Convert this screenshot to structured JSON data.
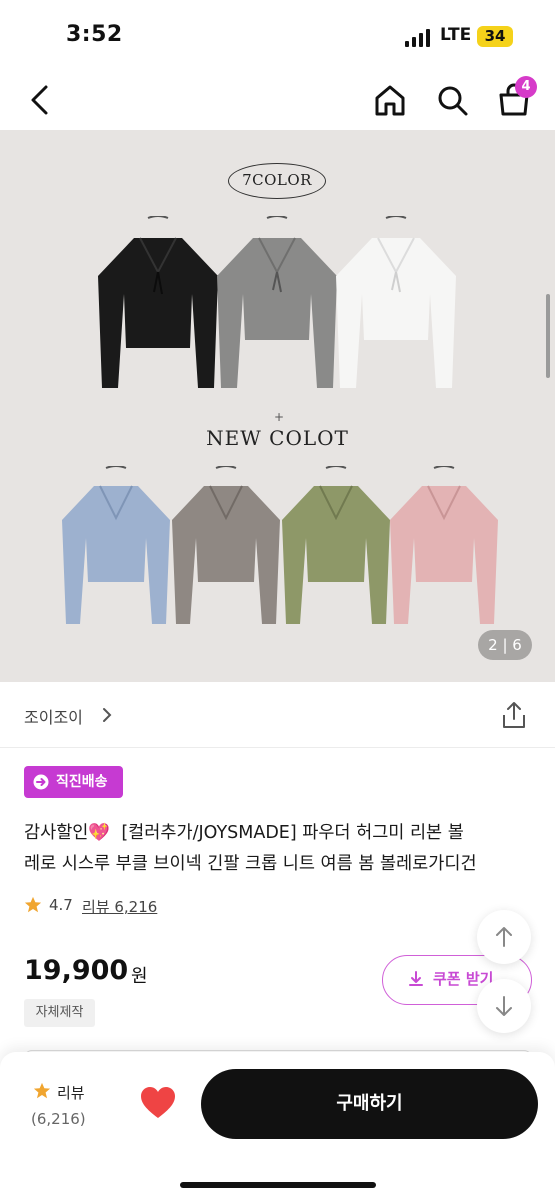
{
  "status_bar": {
    "time": "3:52",
    "network": "LTE",
    "battery": "34"
  },
  "nav": {
    "cart_count": "4",
    "icons": [
      "back-icon",
      "home-icon",
      "search-icon",
      "cart-icon"
    ]
  },
  "hero": {
    "color_count_label": "7COLOR",
    "new_label": "NEW COLOT",
    "plus": "+",
    "page_indicator": "2 | 6",
    "garment_colors": {
      "row1": [
        "#161616",
        "#8a8a89",
        "#f5f5f4"
      ],
      "row2": [
        "#9db1cf",
        "#8f8883",
        "#8e9868",
        "#e3b3b4"
      ]
    }
  },
  "seller": {
    "name": "조이조이"
  },
  "badge": {
    "label": "직진배송"
  },
  "product": {
    "title_prefix": "감사할인",
    "title_emoji": "💖",
    "title_rest": "[컬러추가/JOYSMADE] 파우더 허그미 리본 볼",
    "title_line2": "레로 시스루 부클 브이넥 긴팔 크롭 니트 여름 봄 볼레로가디건",
    "rating": "4.7",
    "review_text": "리뷰 6,216",
    "price": "19,900",
    "currency": "원",
    "tag": "자체제작",
    "coupon_label": "쿠폰 받기"
  },
  "bottom_bar": {
    "review_label": "리뷰",
    "review_count": "(6,216)",
    "buy_label": "구매하기"
  },
  "colors": {
    "accent": "#c63ad2",
    "star": "#f0a530",
    "heart": "#ef4444",
    "buy": "#111111"
  }
}
